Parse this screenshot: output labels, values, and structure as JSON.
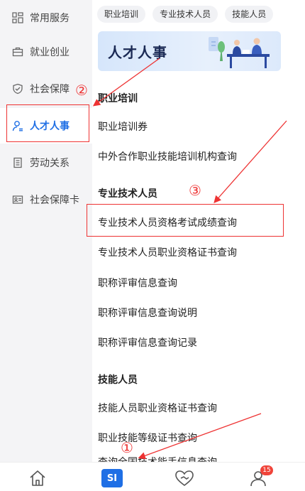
{
  "sidebar": {
    "items": [
      {
        "label": "常用服务",
        "icon": "grid-icon"
      },
      {
        "label": "就业创业",
        "icon": "briefcase-icon"
      },
      {
        "label": "社会保障",
        "icon": "shield-check-icon"
      },
      {
        "label": "人才人事",
        "icon": "person-icon",
        "active": true
      },
      {
        "label": "劳动关系",
        "icon": "document-icon"
      },
      {
        "label": "社会保障卡",
        "icon": "id-card-icon"
      }
    ]
  },
  "chips": [
    "职业培训",
    "专业技术人员",
    "技能人员"
  ],
  "banner": {
    "title": "人才人事"
  },
  "sections": [
    {
      "title": "职业培训",
      "links": [
        "职业培训券",
        "中外合作职业技能培训机构查询"
      ]
    },
    {
      "title": "专业技术人员",
      "links": [
        "专业技术人员资格考试成绩查询",
        "专业技术人员职业资格证书查询",
        "职称评审信息查询",
        "职称评审信息查询说明",
        "职称评审信息查询记录"
      ]
    },
    {
      "title": "技能人员",
      "links": [
        "技能人员职业资格证书查询",
        "职业技能等级证书查询"
      ]
    }
  ],
  "cut_off_text": "查询全国技术能手信息查询",
  "bottom_nav": {
    "si_label": "SI",
    "notification_count": "15"
  },
  "annotations": [
    "①",
    "②",
    "③"
  ],
  "colors": {
    "accent": "#1f6fe5",
    "annotation": "#e33333"
  }
}
